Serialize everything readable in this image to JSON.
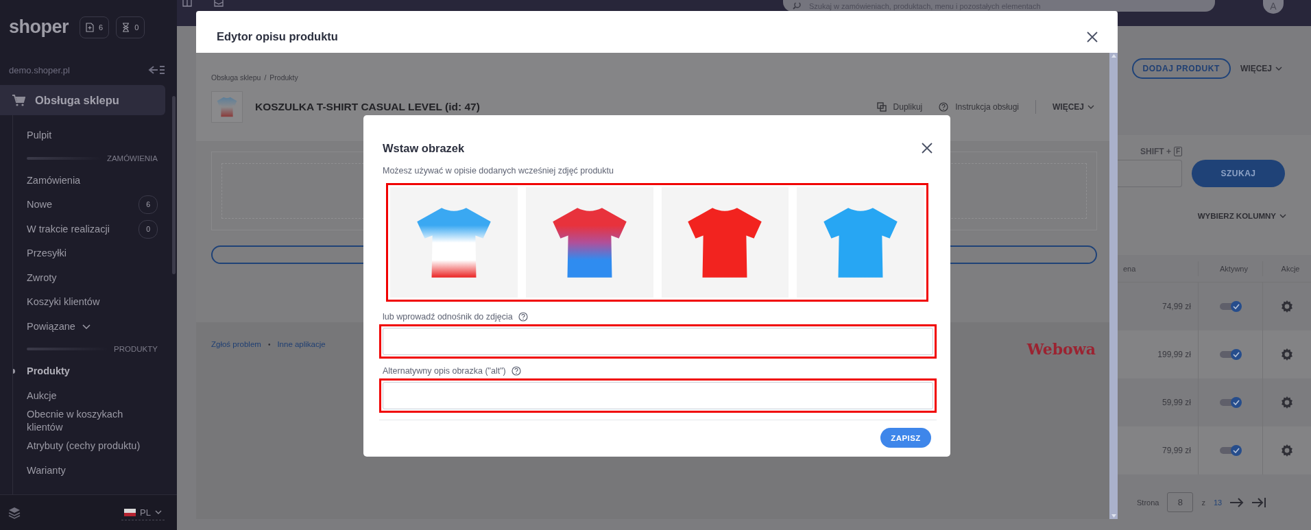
{
  "sidebar": {
    "logo": "shoper",
    "counters": [
      {
        "kind": "new",
        "count": "6"
      },
      {
        "kind": "pending",
        "count": "0"
      }
    ],
    "store": "demo.shoper.pl",
    "section": {
      "label": "Obsługa sklepu",
      "selected": true
    },
    "items": [
      {
        "kind": "item",
        "label": "Pulpit",
        "selected": false
      },
      {
        "kind": "header",
        "label": "ZAMÓWIENIA"
      },
      {
        "kind": "item",
        "label": "Zamówienia",
        "selected": false
      },
      {
        "kind": "item",
        "label": "Nowe",
        "selected": false,
        "badge": "6"
      },
      {
        "kind": "item",
        "label": "W trakcie realizacji",
        "selected": false,
        "badge": "0"
      },
      {
        "kind": "item",
        "label": "Przesyłki",
        "selected": false
      },
      {
        "kind": "item",
        "label": "Zwroty",
        "selected": false
      },
      {
        "kind": "item",
        "label": "Koszyki klientów",
        "selected": false
      },
      {
        "kind": "group",
        "label": "Powiązane",
        "selected": false
      },
      {
        "kind": "header",
        "label": "PRODUKTY"
      },
      {
        "kind": "item",
        "label": "Produkty",
        "selected": true
      },
      {
        "kind": "item",
        "label": "Aukcje",
        "selected": false
      },
      {
        "kind": "item",
        "label": "Obecnie w koszykach klientów",
        "selected": false
      },
      {
        "kind": "item",
        "label": "Atrybuty (cechy produktu)",
        "selected": false
      },
      {
        "kind": "item",
        "label": "Warianty",
        "selected": false
      }
    ],
    "language": "PL"
  },
  "topbar": {
    "search": {
      "placeholder": "Szukaj w zamówieniach, produktach, menu i pozostałych elementach"
    },
    "avatar": "A"
  },
  "page": {
    "add_button": "DODAJ PRODUKT",
    "more": "WIĘCEJ",
    "shortcut": {
      "label": "SHIFT +",
      "key": "F"
    },
    "search_button": "SZUKAJ",
    "columns_button": "WYBIERZ KOLUMNY",
    "table": {
      "columns": [
        "ena",
        "Aktywny",
        "Akcje"
      ],
      "rows": [
        {
          "price": "74,99 zł",
          "active": true
        },
        {
          "price": "199,99 zł",
          "active": true
        },
        {
          "price": "59,99 zł",
          "active": true
        },
        {
          "price": "79,99 zł",
          "active": true
        }
      ]
    },
    "pagination": {
      "label": "Strona",
      "page": "8",
      "of": "z",
      "total": "13"
    }
  },
  "editor": {
    "title": "Edytor opisu produktu",
    "breadcrumb": [
      "Obsługa sklepu",
      "Produkty"
    ],
    "breadcrumb_separator": "/",
    "product_title": "KOSZULKA T-SHIRT CASUAL LEVEL (id: 47)",
    "actions": [
      {
        "kind": "duplicate",
        "label": "Duplikuj"
      },
      {
        "kind": "help",
        "label": "Instrukcja obsługi"
      }
    ],
    "more": "WIĘCEJ",
    "footer_links": [
      "Zgłoś problem",
      "Inne aplikacje"
    ],
    "footer_separator": "•",
    "brand": "Webowa"
  },
  "dialog": {
    "title": "Wstaw obrazek",
    "description": "Możesz używać w opisie dodanych wcześniej zdjęć produktu",
    "images_highlighted": true,
    "images": [
      {
        "kind": "fade",
        "color": "#3aa8f2"
      },
      {
        "kind": "blend",
        "color": "#e8323c"
      },
      {
        "kind": "solid",
        "color": "#f2231f"
      },
      {
        "kind": "solid",
        "color": "#27a6f3"
      }
    ],
    "fields": [
      {
        "label": "lub wprowadź odnośnik do zdjęcia",
        "highlighted": true
      },
      {
        "label": "Alternatywny opis obrazka (\"alt\")",
        "highlighted": true
      }
    ],
    "save_button": "ZAPISZ"
  }
}
